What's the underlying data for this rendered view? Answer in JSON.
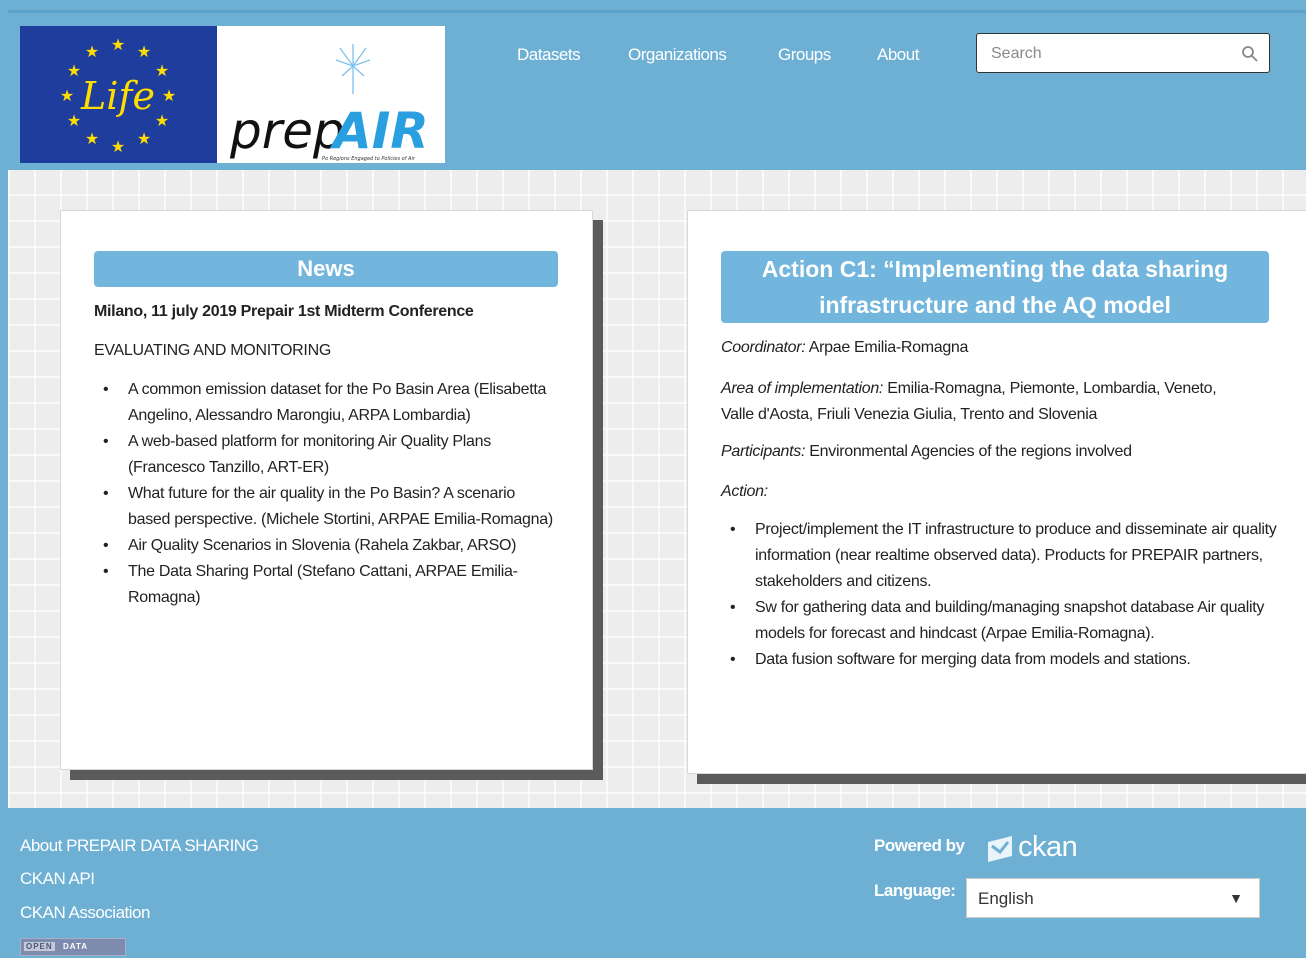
{
  "header": {
    "logo": {
      "life_text": "Life",
      "brand_prefix": "prep",
      "brand_suffix": "AIR",
      "tagline": "Po Regions Engaged to Policies of Air"
    },
    "nav": [
      "Datasets",
      "Organizations",
      "Groups",
      "About"
    ],
    "search": {
      "placeholder": "Search",
      "value": ""
    }
  },
  "news": {
    "title": "News",
    "headline": "Milano, 11 july 2019 Prepair 1st Midterm Conference",
    "subhead": "EVALUATING AND MONITORING",
    "items": [
      "A common emission dataset for the Po Basin Area (Elisabetta Angelino, Alessandro Marongiu, ARPA Lombardia)",
      "A web-based platform for monitoring Air Quality Plans (Francesco Tanzillo, ART-ER)",
      "What future for the air quality in the Po Basin? A scenario based perspective. (Michele Stortini, ARPAE Emilia-Romagna)",
      "Air Quality Scenarios in Slovenia (Rahela Zakbar, ARSO)",
      "The Data Sharing Portal (Stefano Cattani, ARPAE Emilia-Romagna)"
    ]
  },
  "action": {
    "title_line1": "Action C1: “Implementing the data sharing",
    "title_line2": "infrastructure and the AQ model",
    "coordinator_label": "Coordinator:",
    "coordinator_value": " Arpae Emilia-Romagna",
    "area_label": "Area of implementation:",
    "area_value": " Emilia-Romagna, Piemonte, Lombardia, Veneto, Valle d'Aosta, Friuli Venezia Giulia, Trento and Slovenia",
    "participants_label": "Participants:",
    "participants_value": " Environmental Agencies of the regions involved",
    "action_label": "Action:",
    "items": [
      "Project/implement the IT infrastructure to produce and disseminate air quality information (near realtime observed data). Products for PREPAIR partners, stakeholders and citizens.",
      "Sw for gathering data and building/managing snapshot database Air quality models for forecast and hindcast (Arpae Emilia-Romagna).",
      "Data fusion software for merging data from models and stations."
    ]
  },
  "footer": {
    "links": [
      "About PREPAIR DATA SHARING",
      "CKAN API",
      "CKAN Association"
    ],
    "powered_by": "Powered by",
    "ckan": "ckan",
    "language_label": "Language:",
    "language_value": "English",
    "open_data_badge": [
      "OPEN",
      "DATA"
    ]
  },
  "colors": {
    "header_bg": "#6db0d4",
    "title_bg": "#73b6dd",
    "eu_blue": "#1f3d9c",
    "eu_star": "#ffdd00",
    "brand_blue": "#2a9fe0"
  },
  "icons": [
    "search-icon",
    "ckan-logo-icon",
    "chevron-down-icon",
    "eu-stars-icon",
    "dandelion-icon"
  ]
}
